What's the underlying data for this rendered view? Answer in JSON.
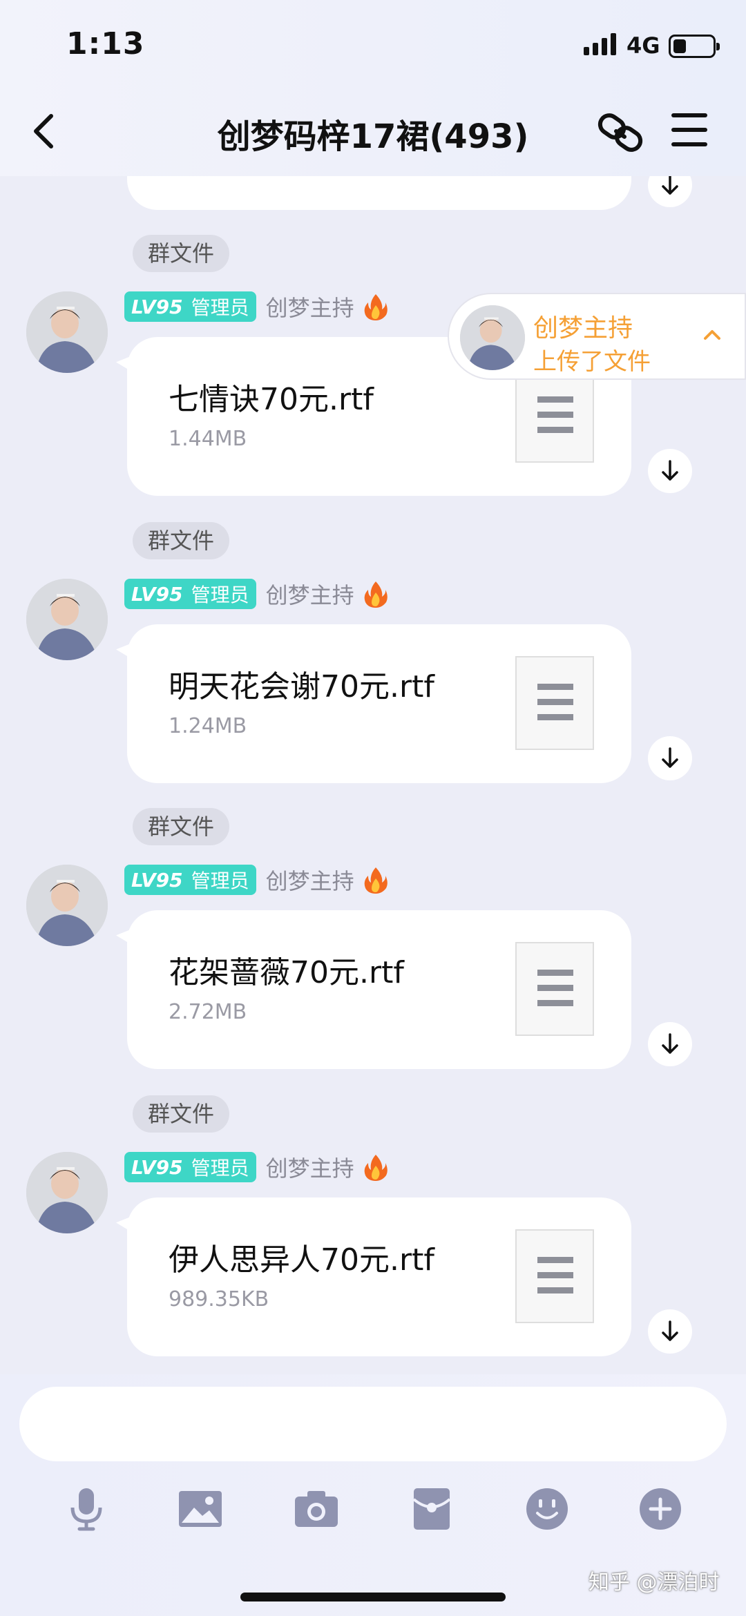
{
  "status": {
    "time": "1:13",
    "network": "4G"
  },
  "header": {
    "title": "创梦码梓17裙(493)"
  },
  "messages": [
    {
      "tag": "群文件",
      "level": "LV95",
      "role": "管理员",
      "sender": "创梦主持",
      "file_name": "七情诀70元.rtf",
      "file_size": "1.44MB"
    },
    {
      "tag": "群文件",
      "level": "LV95",
      "role": "管理员",
      "sender": "创梦主持",
      "file_name": "明天花会谢70元.rtf",
      "file_size": "1.24MB"
    },
    {
      "tag": "群文件",
      "level": "LV95",
      "role": "管理员",
      "sender": "创梦主持",
      "file_name": "花架蔷薇70元.rtf",
      "file_size": "2.72MB"
    },
    {
      "tag": "群文件",
      "level": "LV95",
      "role": "管理员",
      "sender": "创梦主持",
      "file_name": "伊人思异人70元.rtf",
      "file_size": "989.35KB"
    }
  ],
  "notify": {
    "name": "创梦主持",
    "text": "上传了文件"
  },
  "toolbar": [
    "microphone-icon",
    "image-icon",
    "camera-icon",
    "red-packet-icon",
    "emoji-icon",
    "plus-icon"
  ],
  "watermark": "知乎 @漂泊时",
  "colors": {
    "accent": "#3ed6c6",
    "notify": "#f5a035",
    "background": "#ecedf7"
  }
}
